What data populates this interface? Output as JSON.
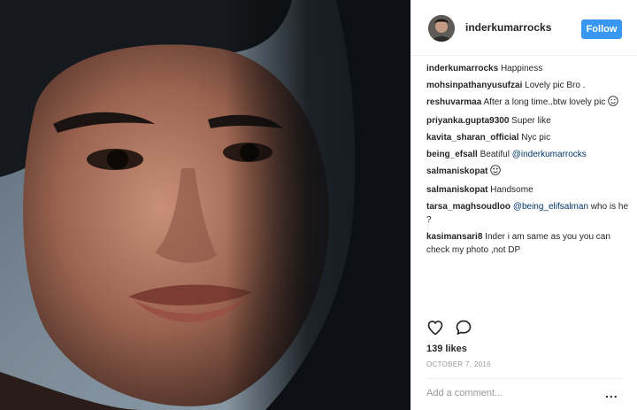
{
  "post": {
    "username": "inderkumarrocks",
    "follow_label": "Follow",
    "likes": "139 likes",
    "date": "OCTOBER 7, 2016",
    "comment_placeholder": "Add a comment...",
    "more_label": "..."
  },
  "comments": [
    {
      "user": "inderkumarrocks",
      "text": "Happiness"
    },
    {
      "user": "mohsinpathanyusufzai",
      "text": "Lovely pic Bro ."
    },
    {
      "user": "reshuvarmaa",
      "text": "After a long time..btw lovely pic",
      "emoji": "smile-emoji"
    },
    {
      "user": "priyanka.gupta9300",
      "text": "Super like"
    },
    {
      "user": "kavita_sharan_official",
      "text": "Nyc pic"
    },
    {
      "user": "being_efsall",
      "text": "Beatiful",
      "mention": "@inderkumarrocks"
    },
    {
      "user": "salmaniskopat",
      "text": "",
      "emoji": "heart-eyes-emoji"
    },
    {
      "user": "salmaniskopat",
      "text": "Handsome"
    },
    {
      "user": "tarsa_maghsoudloo",
      "text": "",
      "mention": "@being_elifsalman",
      "text_after": "who is he ?"
    },
    {
      "user": "kasimansari8",
      "text": "Inder i am same as you you can check my photo ,not DP"
    }
  ],
  "icons": {
    "like": "heart-icon",
    "comment": "comment-icon",
    "more": "more-options-icon"
  },
  "colors": {
    "follow_button": "#3897f0",
    "mention": "#003569",
    "text": "#262626",
    "muted": "#999999"
  }
}
